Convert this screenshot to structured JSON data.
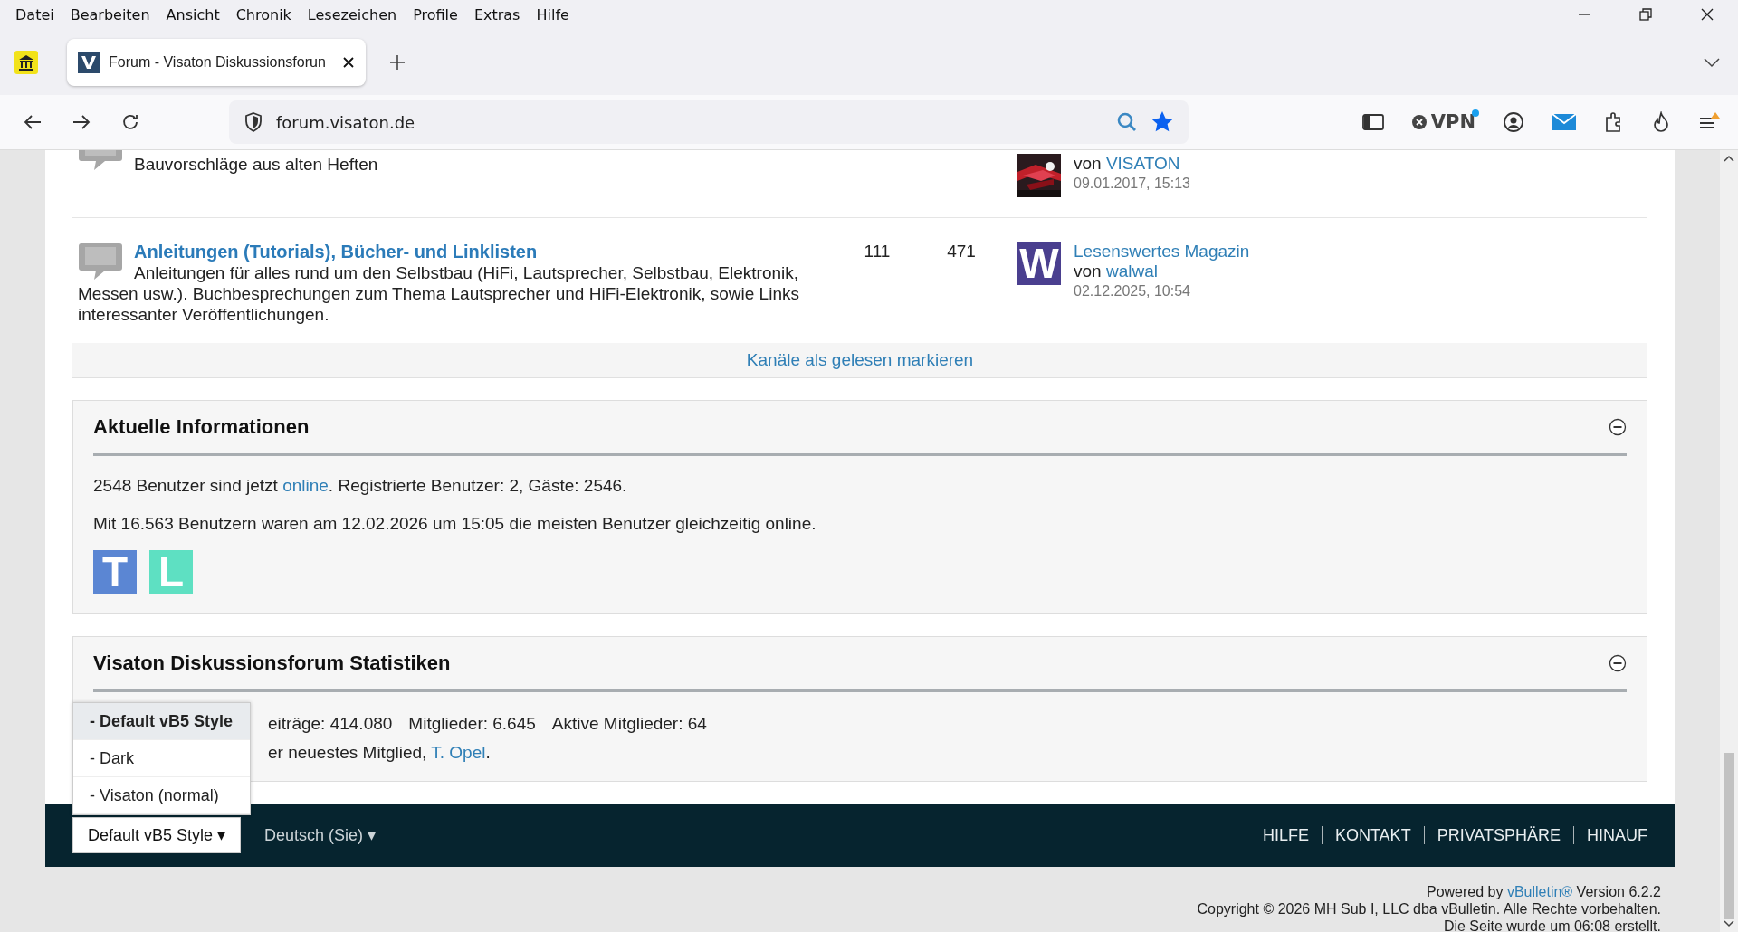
{
  "menu": [
    "Datei",
    "Bearbeiten",
    "Ansicht",
    "Chronik",
    "Lesezeichen",
    "Profile",
    "Extras",
    "Hilfe"
  ],
  "tabs": [
    {
      "title": "Forum - Visaton Diskussionsforun",
      "selected": true
    }
  ],
  "url": "forum.visaton.de",
  "vpn": "VPN",
  "forums": [
    {
      "description": "Bauvorschläge aus alten Heften",
      "last_post": {
        "by": "von",
        "author": "VISATON",
        "date": "09.01.2017, 15:13"
      }
    },
    {
      "title": "Anleitungen (Tutorials), Bücher- und Linklisten",
      "description": "Anleitungen für alles rund um den Selbstbau (HiFi, Lautsprecher, Selbstbau, Elektronik, Messen usw.). Buchbesprechungen zum Thema Lautsprecher und HiFi-Elektronik, sowie Links interessanter Veröffentlichungen.",
      "threads": "111",
      "posts": "471",
      "last_post": {
        "title": "Lesenswertes Magazin",
        "by": "von",
        "author": "walwal",
        "date": "02.12.2025, 10:54",
        "avatar": {
          "kind": "letter",
          "letter": "W",
          "color": "#4a3f8f"
        }
      }
    }
  ],
  "mark_read": "Kanäle als gelesen markieren",
  "info": {
    "title": "Aktuelle Informationen",
    "expanded": true,
    "online_line": {
      "before": "2548 Benutzer sind jetzt ",
      "link": "online",
      "after": ". Registrierte Benutzer: 2, Gäste: 2546."
    },
    "record_line": "Mit 16.563 Benutzern waren am 12.02.2026 um 15:05 die meisten Benutzer gleichzeitig online.",
    "users": [
      {
        "letter": "T",
        "color": "#5b86d3"
      },
      {
        "letter": "L",
        "color": "#5ee0c2"
      }
    ]
  },
  "stats": {
    "title": "Visaton Diskussionsforum Statistiken",
    "expanded": true,
    "counts": [
      "eiträge: 414.080",
      "Mitglieder: 6.645",
      "Aktive Mitglieder: 64"
    ],
    "newest": {
      "before": "er neuestes Mitglied, ",
      "link": "T. Opel",
      "after": "."
    }
  },
  "style_menu": {
    "options": [
      {
        "label": "- Default vB5 Style",
        "selected": true
      },
      {
        "label": "- Dark",
        "selected": false
      },
      {
        "label": "- Visaton (normal)",
        "selected": false
      }
    ],
    "button": "Default vB5 Style",
    "caret": "▾"
  },
  "language": {
    "label": "Deutsch (Sie)",
    "caret": "▾"
  },
  "footer_links": [
    "HILFE",
    "KONTAKT",
    "PRIVATSPHÄRE",
    "HINAUF"
  ],
  "powered": {
    "before": "Powered by ",
    "link": "vBulletin®",
    "after": " Version 6.2.2"
  },
  "copyright": "Copyright © 2026 MH Sub I, LLC dba vBulletin. Alle Rechte vorbehalten.",
  "generated": "Die Seite wurde um 06:08 erstellt."
}
